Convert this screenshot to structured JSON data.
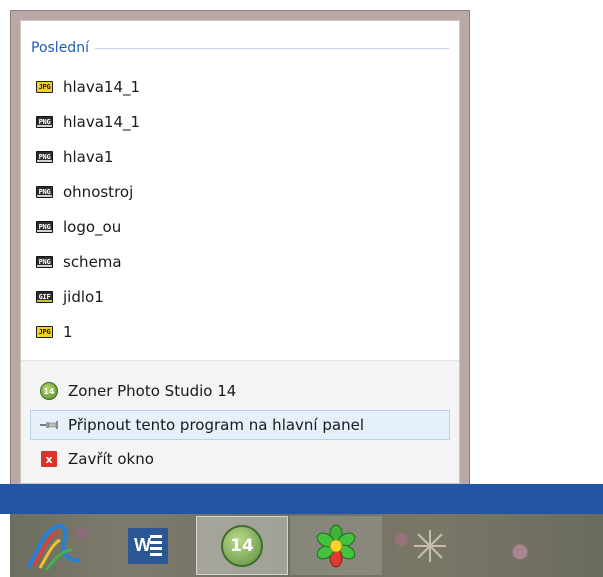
{
  "jumplist": {
    "section_title": "Poslední",
    "recent_items": [
      {
        "label": "hlava14_1",
        "icon": "jpg-file-icon",
        "icon_text": "JPG"
      },
      {
        "label": "hlava14_1",
        "icon": "png-file-icon",
        "icon_text": "PNG"
      },
      {
        "label": "hlava1",
        "icon": "png-file-icon",
        "icon_text": "PNG"
      },
      {
        "label": "ohnostroj",
        "icon": "png-file-icon",
        "icon_text": "PNG"
      },
      {
        "label": "logo_ou",
        "icon": "png-file-icon",
        "icon_text": "PNG"
      },
      {
        "label": "schema",
        "icon": "png-file-icon",
        "icon_text": "PNG"
      },
      {
        "label": "jidlo1",
        "icon": "gif-file-icon",
        "icon_text": "GIF"
      },
      {
        "label": "1",
        "icon": "jpg-file-icon",
        "icon_text": "JPG"
      }
    ],
    "tasks": {
      "app": {
        "label": "Zoner Photo Studio 14",
        "icon": "zoner-photo-studio-icon",
        "icon_text": "14"
      },
      "pin": {
        "label": "Připnout tento program na hlavní panel",
        "icon": "pin-icon"
      },
      "close": {
        "label": "Zavřít okno",
        "icon": "close-window-icon",
        "icon_text": "x"
      }
    }
  },
  "taskbar": {
    "items": [
      {
        "name": "paint-app-icon"
      },
      {
        "name": "word-icon",
        "icon_text": "W"
      },
      {
        "name": "zoner-photo-studio-icon",
        "icon_text": "14",
        "active": true
      },
      {
        "name": "icq-icon"
      },
      {
        "name": "unknown-app-icon"
      }
    ]
  },
  "colors": {
    "section_title": "#1e5fb4",
    "taskbar_strip": "#2355a3",
    "close_red": "#d9342b",
    "hover_blue": "#e6f0fa"
  }
}
